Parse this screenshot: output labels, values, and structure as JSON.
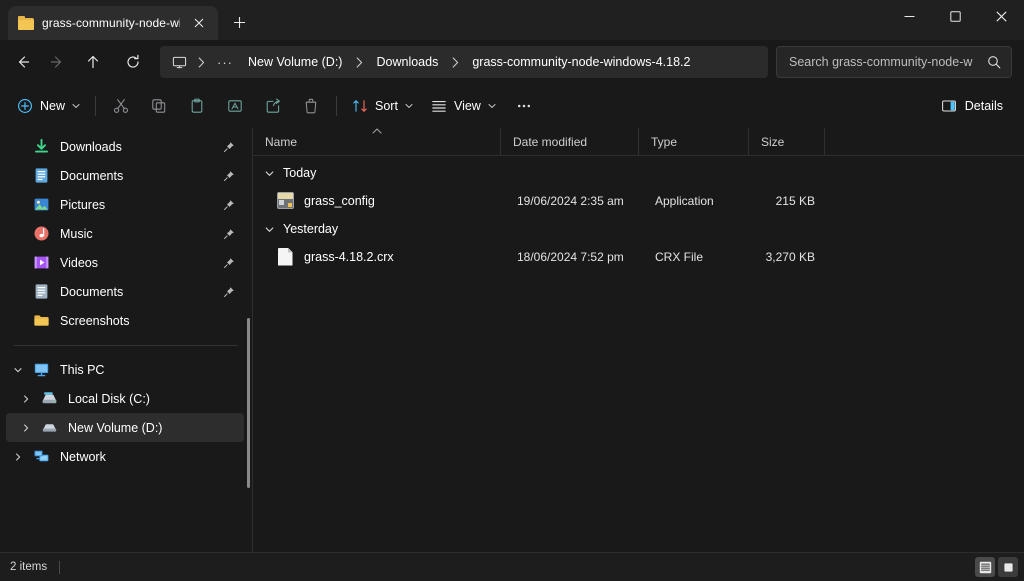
{
  "window": {
    "tab_title": "grass-community-node-windo",
    "controls": {
      "minimize": "Minimize",
      "maximize": "Maximize",
      "close": "Close",
      "new_tab": "New tab",
      "close_tab": "Close tab"
    }
  },
  "address_bar": {
    "back": "Back",
    "forward": "Forward",
    "up": "Up to Downloads",
    "refresh": "Refresh",
    "root_icon": "this-pc",
    "ellipsis": "···",
    "crumbs": [
      {
        "label": "New Volume (D:)"
      },
      {
        "label": "Downloads"
      },
      {
        "label": "grass-community-node-windows-4.18.2"
      }
    ],
    "search_placeholder": "Search grass-community-node-w",
    "search_value": ""
  },
  "command_bar": {
    "new_label": "New",
    "cut_label": "Cut",
    "copy_label": "Copy",
    "paste_label": "Paste",
    "rename_label": "Rename",
    "share_label": "Share",
    "delete_label": "Delete",
    "sort_label": "Sort",
    "view_label": "View",
    "more_label": "See more",
    "details_label": "Details"
  },
  "nav_pane": {
    "quick_access": [
      {
        "label": "Downloads",
        "icon": "downloads-icon",
        "pinned": true,
        "selected": false
      },
      {
        "label": "Documents",
        "icon": "documents-icon",
        "pinned": true,
        "selected": false
      },
      {
        "label": "Pictures",
        "icon": "pictures-icon",
        "pinned": true,
        "selected": false
      },
      {
        "label": "Music",
        "icon": "music-icon",
        "pinned": true,
        "selected": false
      },
      {
        "label": "Videos",
        "icon": "videos-icon",
        "pinned": true,
        "selected": false
      },
      {
        "label": "Documents",
        "icon": "documents-onedrive-icon",
        "pinned": true,
        "selected": false
      },
      {
        "label": "Screenshots",
        "icon": "folder-icon",
        "pinned": false,
        "selected": false
      }
    ],
    "tree": [
      {
        "label": "This PC",
        "icon": "this-pc-icon",
        "expanded": true,
        "indent": 0,
        "selected": false
      },
      {
        "label": "Local Disk (C:)",
        "icon": "local-disk-icon",
        "expanded": false,
        "indent": 1,
        "selected": false
      },
      {
        "label": "New Volume (D:)",
        "icon": "drive-icon",
        "expanded": false,
        "indent": 1,
        "selected": true
      },
      {
        "label": "Network",
        "icon": "network-icon",
        "expanded": false,
        "indent": 0,
        "selected": false
      }
    ]
  },
  "file_list": {
    "columns": [
      {
        "key": "name",
        "label": "Name",
        "sorted": "ascending"
      },
      {
        "key": "date",
        "label": "Date modified",
        "sorted": ""
      },
      {
        "key": "type",
        "label": "Type",
        "sorted": ""
      },
      {
        "key": "size",
        "label": "Size",
        "sorted": ""
      }
    ],
    "groups": [
      {
        "title": "Today",
        "expanded": true,
        "rows": [
          {
            "name": "grass_config",
            "date": "19/06/2024 2:35 am",
            "type": "Application",
            "size": "215 KB",
            "icon": "application-icon"
          }
        ]
      },
      {
        "title": "Yesterday",
        "expanded": true,
        "rows": [
          {
            "name": "grass-4.18.2.crx",
            "date": "18/06/2024 7:52 pm",
            "type": "CRX File",
            "size": "3,270 KB",
            "icon": "generic-file-icon"
          }
        ]
      }
    ]
  },
  "status_bar": {
    "item_count": "2 items",
    "details_view": "Details view",
    "large_icons_view": "Large icons view"
  },
  "colors": {
    "window_bg": "#191919",
    "titlebar_bg": "#202020",
    "tab_active_bg": "#2d2d2d",
    "accent_folder": "#f3c553",
    "selection_bg": "#2d2d2d",
    "text_primary": "#ffffff",
    "text_secondary": "#cfcfcf"
  }
}
